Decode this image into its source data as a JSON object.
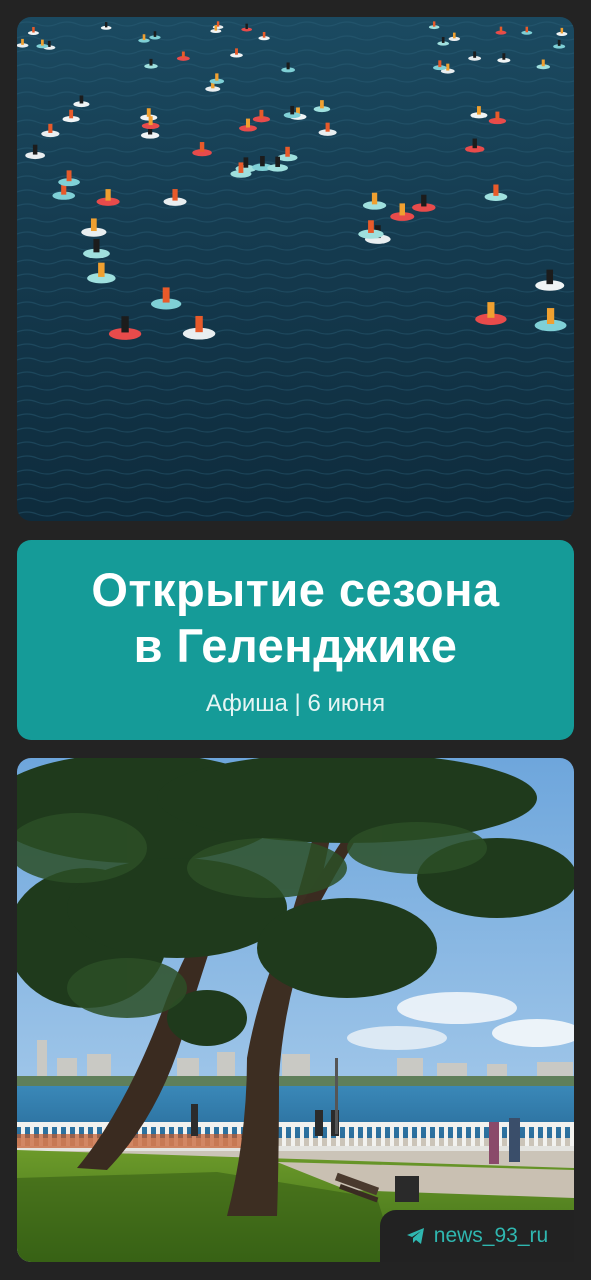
{
  "title_card": {
    "line1": "Открытие сезона",
    "line2": "в Геленджике",
    "subtitle": "Афиша | 6 июня"
  },
  "watermark": {
    "icon": "telegram-paper-plane-icon",
    "handle": "news_93_ru"
  },
  "colors": {
    "background": "#232323",
    "card": "#159b98",
    "watermark_text": "#2fb7b0"
  }
}
